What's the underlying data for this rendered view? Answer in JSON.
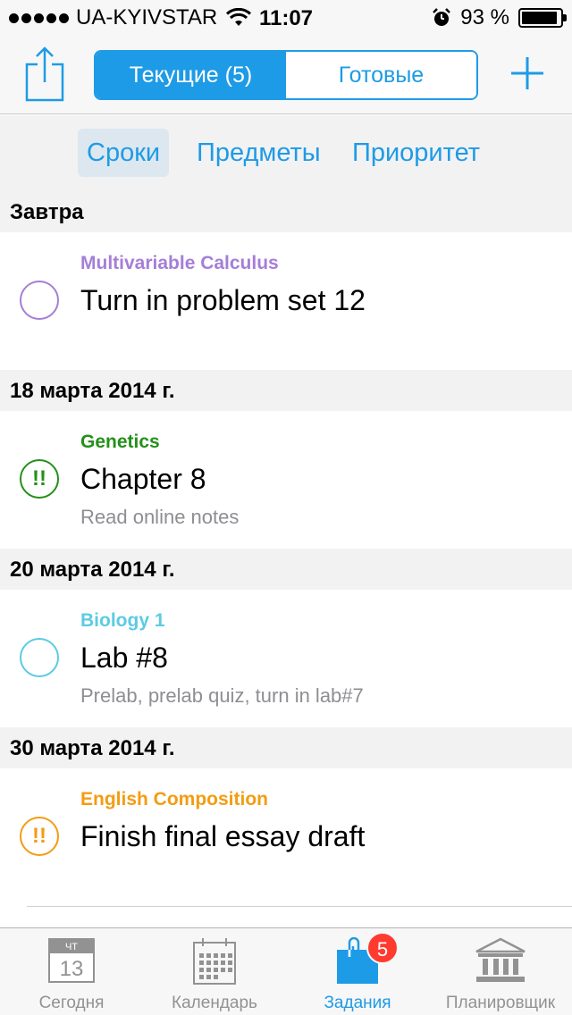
{
  "status_bar": {
    "carrier": "UA-KYIVSTAR",
    "time": "11:07",
    "battery_percent": "93 %",
    "battery_level": 0.93
  },
  "nav": {
    "segments": [
      {
        "label": "Текущие (5)",
        "selected": true
      },
      {
        "label": "Готовые",
        "selected": false
      }
    ],
    "share_icon": "share-icon",
    "add_icon": "plus-icon"
  },
  "sort_options": [
    {
      "label": "Сроки",
      "selected": true
    },
    {
      "label": "Предметы",
      "selected": false
    },
    {
      "label": "Приоритет",
      "selected": false
    }
  ],
  "sections": [
    {
      "header": "Завтра",
      "tasks": [
        {
          "subject": "Multivariable Calculus",
          "title": "Turn in problem set 12",
          "note": "",
          "priority_mark": "",
          "color": "#a57ed8"
        }
      ]
    },
    {
      "header": "18 марта 2014 г.",
      "tasks": [
        {
          "subject": "Genetics",
          "title": "Chapter 8",
          "note": "Read online notes",
          "priority_mark": "!!",
          "color": "#24901a"
        }
      ]
    },
    {
      "header": "20 марта 2014 г.",
      "tasks": [
        {
          "subject": "Biology 1",
          "title": "Lab #8",
          "note": "Prelab, prelab quiz, turn in lab#7",
          "priority_mark": "",
          "color": "#5ccbe2"
        }
      ]
    },
    {
      "header": "30 марта 2014 г.",
      "tasks": [
        {
          "subject": "English Composition",
          "title": "Finish final essay draft",
          "note": "",
          "priority_mark": "!!",
          "color": "#f39c12"
        }
      ]
    }
  ],
  "tab_bar": {
    "tabs": [
      {
        "label": "Сегодня",
        "icon": "today-calendar-icon",
        "icon_day": "ЧТ",
        "icon_date": "13",
        "active": false
      },
      {
        "label": "Календарь",
        "icon": "calendar-grid-icon",
        "active": false
      },
      {
        "label": "Задания",
        "icon": "paperclip-folder-icon",
        "badge": "5",
        "active": true
      },
      {
        "label": "Планировщик",
        "icon": "building-icon",
        "active": false
      }
    ]
  },
  "colors": {
    "accent": "#1e9be6",
    "badge": "#ff3b30"
  }
}
